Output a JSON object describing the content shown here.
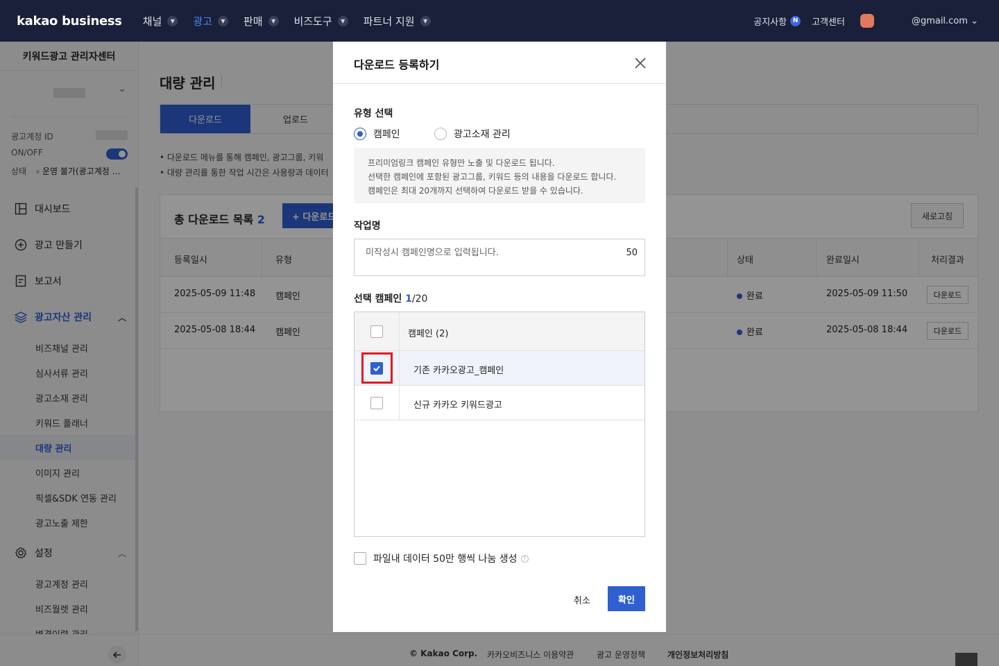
{
  "topnav": {
    "logo": "kakao business",
    "items": [
      {
        "label": "채널",
        "active": false
      },
      {
        "label": "광고",
        "active": true
      },
      {
        "label": "판매",
        "active": false
      },
      {
        "label": "비즈도구",
        "active": false
      },
      {
        "label": "파트너 지원",
        "active": false
      }
    ],
    "notice": "공지사항",
    "notice_badge": "N",
    "support": "고객센터",
    "email": "@gmail.com"
  },
  "sidebar": {
    "title": "키워드광고 관리자센터",
    "account_id_label": "광고계정 ID",
    "onoff_label": "ON/OFF",
    "status_label": "상태",
    "status_value": "운영 불가(광고계정 …",
    "menu": {
      "dashboard": "대시보드",
      "create_ad": "광고 만들기",
      "report": "보고서",
      "asset_mgmt": "광고자산 관리",
      "sub": [
        "비즈채널 관리",
        "심사서류 관리",
        "광고소재 관리",
        "키워드 플래너",
        "대량 관리",
        "이미지 관리",
        "픽셀&SDK 연동 관리",
        "광고노출 제한"
      ],
      "settings": "설정",
      "settings_sub": [
        "광고계정 관리",
        "비즈월렛 관리",
        "변경이력 관리"
      ]
    }
  },
  "main": {
    "title": "대량 관리",
    "tabs": [
      "다운로드",
      "업로드"
    ],
    "notes": [
      "• 다운로드 메뉴를 통해 캠페인, 광고그룹, 키워",
      "• 대량 관리를 통한 작업 시간은 사용량과 데이터"
    ],
    "list_title": "총 다운로드 목록",
    "list_count": "2",
    "add_button": "+ 다운로드",
    "refresh_button": "새로고침",
    "columns": {
      "date": "등록일시",
      "type": "유형",
      "status": "상태",
      "done_at": "완료일시",
      "result": "처리결과"
    },
    "rows": [
      {
        "date": "2025-05-09 11:48",
        "type": "캠페인",
        "status": "완료",
        "done_at": "2025-05-09 11:50",
        "action": "다운로드"
      },
      {
        "date": "2025-05-08 18:44",
        "type": "캠페인",
        "status": "완료",
        "done_at": "2025-05-08 18:44",
        "action": "다운로드"
      }
    ]
  },
  "footer": {
    "copyright": "© Kakao Corp.",
    "links": [
      "카카오비즈니스 이용약관",
      "광고 운영정책",
      "개인정보처리방침"
    ]
  },
  "modal": {
    "title": "다운로드 등록하기",
    "type_label": "유형 선택",
    "type_options": [
      "캠페인",
      "광고소재 관리"
    ],
    "selected_type": "캠페인",
    "info_lines": [
      "프리미엄링크 캠페인 유형만 노출 및 다운로드 됩니다.",
      "선택한 캠페인에 포함된 광고그룹, 키워드 등의 내용을 다운로드 합니다.",
      "캠페인은 최대 20개까지 선택하여 다운로드 받을 수 있습니다."
    ],
    "job_name_label": "작업명",
    "job_name_placeholder": "미작성시 캠페인명으로 입력됩니다.",
    "job_name_max": "50",
    "selected_label": "선택 캠페인",
    "selected_count": "1",
    "selected_max": "/20",
    "campaign_header": "캠페인 (2)",
    "campaigns": [
      {
        "name": "기존 카카오광고_캠페인",
        "checked": true
      },
      {
        "name": "신규 카카오 키워드광고",
        "checked": false
      }
    ],
    "split_option": "파일내 데이터 50만 행씩 나눔 생성",
    "cancel": "취소",
    "confirm": "확인"
  }
}
